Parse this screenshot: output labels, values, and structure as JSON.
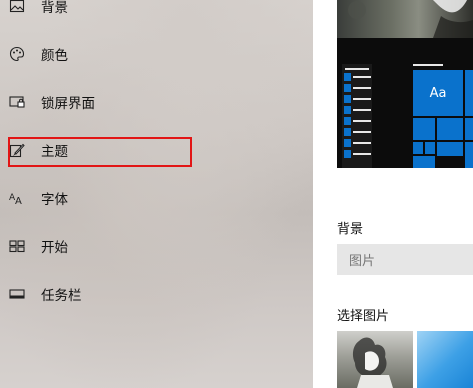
{
  "sidebar": {
    "items": [
      {
        "label": "背景",
        "icon": "picture-icon"
      },
      {
        "label": "颜色",
        "icon": "palette-icon"
      },
      {
        "label": "锁屏界面",
        "icon": "lock-screen-icon"
      },
      {
        "label": "主题",
        "icon": "brush-icon"
      },
      {
        "label": "字体",
        "icon": "font-icon"
      },
      {
        "label": "开始",
        "icon": "start-icon"
      },
      {
        "label": "任务栏",
        "icon": "taskbar-icon"
      }
    ],
    "highlight_color": "#e21515"
  },
  "main": {
    "preview": {
      "tile_label": "Aa",
      "accent_color": "#0a72cc"
    },
    "background_section": {
      "title": "背景",
      "select_value": "图片"
    },
    "choose_picture_section": {
      "title": "选择图片"
    }
  }
}
